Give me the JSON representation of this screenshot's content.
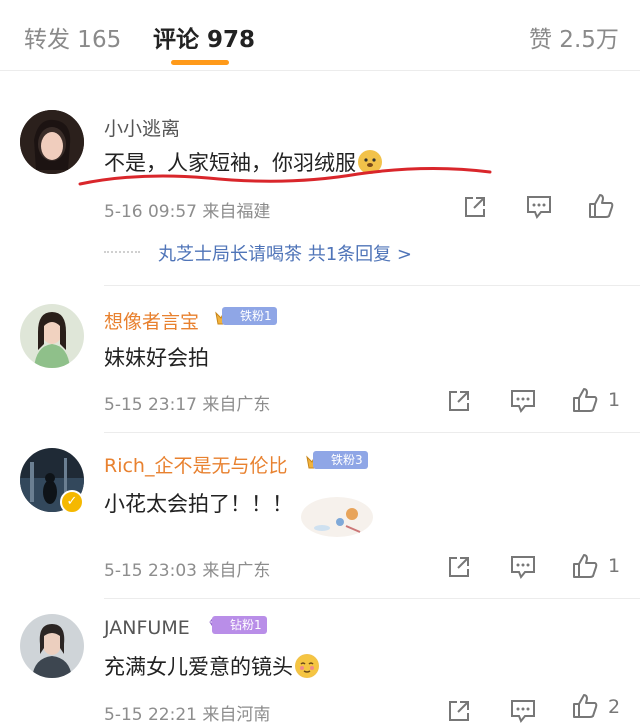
{
  "tabs": {
    "reposts": "转发 165",
    "comments": "评论 978",
    "likes": "赞 2.5万"
  },
  "colors": {
    "accent": "#ff9a1a",
    "name_orange": "#e8812f",
    "link_blue": "#4f74b8",
    "underline_red": "#d9262b"
  },
  "comments": [
    {
      "user": "小小逃离",
      "text": "不是，人家短袖，你羽绒服",
      "emoji": "doge-emoji",
      "time": "5-16 09:57",
      "location": "来自福建",
      "like_count": "",
      "reply_summary": "丸芝士局长请喝茶  共1条回复 >"
    },
    {
      "user": "想像者言宝",
      "badge": "铁粉1",
      "text": "妹妹好会拍",
      "time": "5-15 23:17",
      "location": "来自广东",
      "like_count": "1"
    },
    {
      "user": "Rich_企不是无与伦比",
      "badge": "铁粉3",
      "text": "小花太会拍了！！！",
      "time": "5-15 23:03",
      "location": "来自广东",
      "like_count": "1"
    },
    {
      "user": "JANFUME",
      "badge": "钻粉1",
      "text": "充满女儿爱意的镜头",
      "emoji": "shy-emoji",
      "time": "5-15 22:21",
      "location": "来自河南",
      "like_count": "2"
    }
  ]
}
